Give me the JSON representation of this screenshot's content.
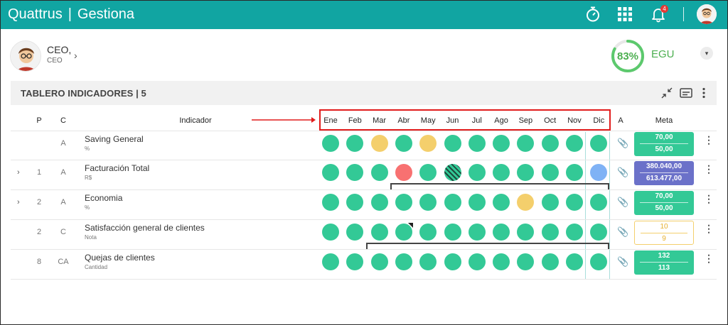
{
  "app": {
    "brand_left": "Quattrus",
    "brand_sep": "|",
    "brand_right": "Gestiona",
    "notifications": "4"
  },
  "profile": {
    "name": "CEO,",
    "role": "CEO",
    "score": "83%",
    "score_fraction": 0.83,
    "unit": "EGU"
  },
  "panel": {
    "title": "TABLERO INDICADORES | 5"
  },
  "headers": {
    "p": "P",
    "c": "C",
    "indicador": "Indicador",
    "a": "A",
    "meta": "Meta",
    "months": [
      "Ene",
      "Feb",
      "Mar",
      "Abr",
      "May",
      "Jun",
      "Jul",
      "Ago",
      "Sep",
      "Oct",
      "Nov",
      "Dic"
    ]
  },
  "rows": [
    {
      "expandable": false,
      "p": "",
      "c": "A",
      "name": "Saving General",
      "unit": "%",
      "status": [
        "green",
        "green",
        "yellow",
        "green",
        "yellow",
        "green",
        "green",
        "green",
        "green",
        "green",
        "green",
        "green"
      ],
      "meta_top": "70,00",
      "meta_bottom": "50,00",
      "meta_style": "green"
    },
    {
      "expandable": true,
      "p": "1",
      "c": "A",
      "name": "Facturación Total",
      "unit": "R$",
      "status": [
        "green",
        "green",
        "green",
        "red",
        "green",
        "hatched",
        "green",
        "green",
        "green",
        "green",
        "green",
        "blue"
      ],
      "meta_top": "380.040,00",
      "meta_bottom": "613.477,00",
      "meta_style": "blue"
    },
    {
      "expandable": true,
      "p": "2",
      "c": "A",
      "name": "Economia",
      "unit": "%",
      "status": [
        "green",
        "green",
        "green",
        "green",
        "green",
        "green",
        "green",
        "green",
        "yellow",
        "green",
        "green",
        "green"
      ],
      "meta_top": "70,00",
      "meta_bottom": "50,00",
      "meta_style": "green"
    },
    {
      "expandable": false,
      "p": "2",
      "c": "C",
      "name": "Satisfacción general de clientes",
      "unit": "Nota",
      "status": [
        "green",
        "green",
        "green",
        "green",
        "green",
        "green",
        "green",
        "green",
        "green",
        "green",
        "green",
        "green"
      ],
      "meta_top": "10",
      "meta_bottom": "9",
      "meta_style": "outline"
    },
    {
      "expandable": false,
      "p": "8",
      "c": "CA",
      "name": "Quejas de clientes",
      "unit": "Cantidad",
      "status": [
        "green",
        "green",
        "green",
        "green",
        "green",
        "green",
        "green",
        "green",
        "green",
        "green",
        "green",
        "green"
      ],
      "meta_top": "132",
      "meta_bottom": "113",
      "meta_style": "green"
    }
  ],
  "colors": {
    "topbar": "#11a5a2",
    "green": "#33c996",
    "yellow": "#f4cf6c",
    "red": "#f87171",
    "blue": "#7fb2f5",
    "meta_blue": "#6b71c9"
  },
  "icons": [
    "stopwatch-icon",
    "apps-grid-icon",
    "bell-icon",
    "user-avatar-icon",
    "chevron-right-icon",
    "chevron-down-icon",
    "compress-icon",
    "caption-icon",
    "more-vertical-icon",
    "paperclip-icon",
    "expand-row-icon"
  ]
}
